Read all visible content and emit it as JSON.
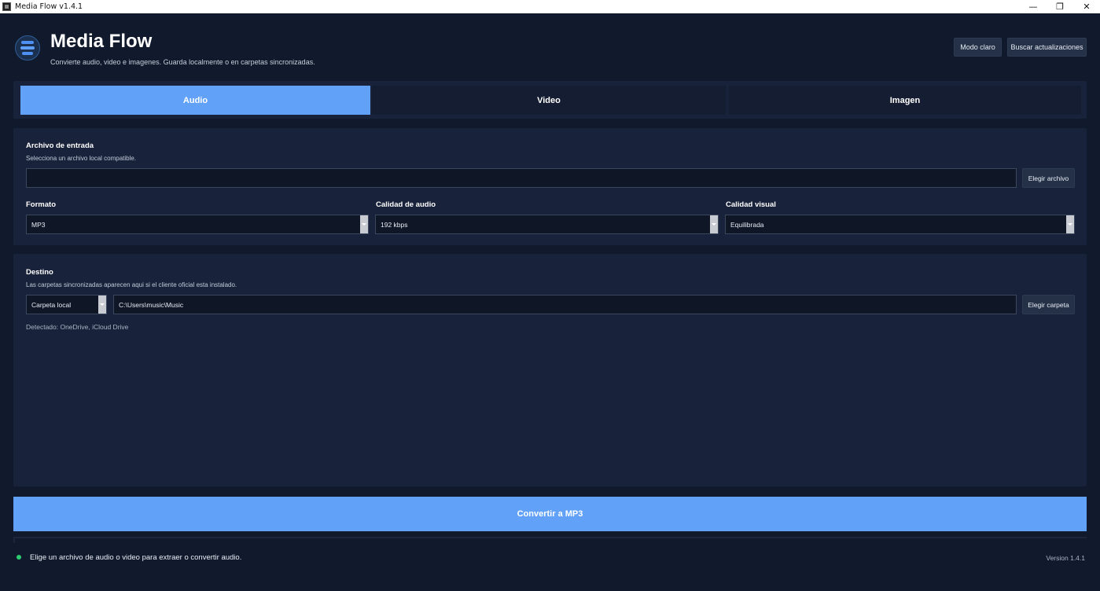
{
  "window": {
    "title": "Media Flow v1.4.1",
    "controls": {
      "minimize": "—",
      "maximize": "❐",
      "close": "✕"
    }
  },
  "header": {
    "title": "Media Flow",
    "subtitle": "Convierte audio, video e imagenes. Guarda localmente o en carpetas sincronizadas.",
    "theme_button": "Modo claro",
    "updates_button": "Buscar actualizaciones"
  },
  "tabs": [
    {
      "label": "Audio",
      "active": true
    },
    {
      "label": "Video",
      "active": false
    },
    {
      "label": "Imagen",
      "active": false
    }
  ],
  "input_section": {
    "title": "Archivo de entrada",
    "hint": "Selecciona un archivo local compatible.",
    "file_value": "",
    "choose_button": "Elegir archivo",
    "format": {
      "label": "Formato",
      "value": "MP3"
    },
    "audio_quality": {
      "label": "Calidad de audio",
      "value": "192 kbps"
    },
    "visual_quality": {
      "label": "Calidad visual",
      "value": "Equilibrada"
    }
  },
  "destination": {
    "title": "Destino",
    "hint": "Las carpetas sincronizadas aparecen aqui si el cliente oficial esta instalado.",
    "location_type": "Carpeta local",
    "path": "C:\\Users\\music\\Music",
    "choose_button": "Elegir carpeta",
    "detected": "Detectado: OneDrive, iCloud Drive"
  },
  "convert_button": "Convertir a MP3",
  "status": {
    "text": "Elige un archivo de audio o video para extraer o convertir audio.",
    "indicator_color": "#2ecc71"
  },
  "version": "Version 1.4.1",
  "colors": {
    "accent": "#61a2f8",
    "background": "#111a2c",
    "panel": "#18223a"
  }
}
